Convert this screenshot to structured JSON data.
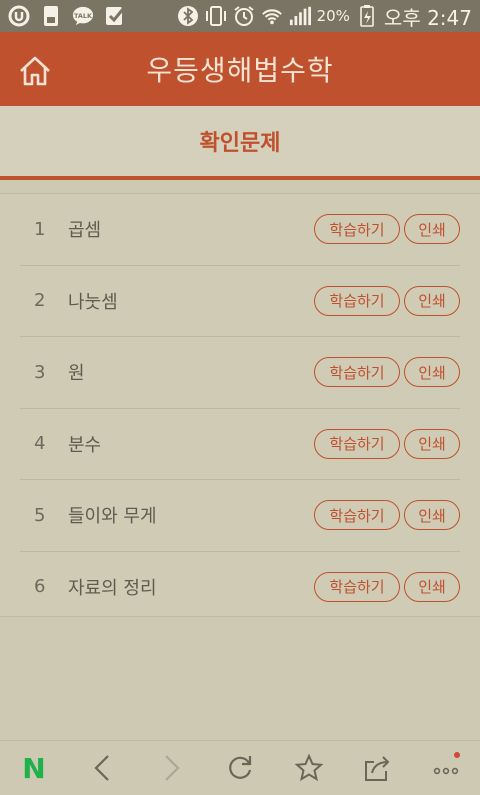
{
  "status_bar": {
    "icons": [
      "u-plus-icon",
      "sim-icon",
      "talk-icon",
      "check-icon",
      "bluetooth-icon",
      "vibrate-icon",
      "alarm-icon",
      "wifi-icon",
      "signal-icon",
      "battery-icon"
    ],
    "talk_label": "TALK",
    "battery": "20%",
    "time": "오후 2:47"
  },
  "app": {
    "title": "우등생해법수학",
    "accent_color": "#c0512f"
  },
  "section": {
    "title": "확인문제"
  },
  "items": [
    {
      "num": "1",
      "title": "곱셈",
      "study": "학습하기",
      "print": "인쇄"
    },
    {
      "num": "2",
      "title": "나눗셈",
      "study": "학습하기",
      "print": "인쇄"
    },
    {
      "num": "3",
      "title": "원",
      "study": "학습하기",
      "print": "인쇄"
    },
    {
      "num": "4",
      "title": "분수",
      "study": "학습하기",
      "print": "인쇄"
    },
    {
      "num": "5",
      "title": "들이와 무게",
      "study": "학습하기",
      "print": "인쇄"
    },
    {
      "num": "6",
      "title": "자료의 정리",
      "study": "학습하기",
      "print": "인쇄"
    }
  ],
  "toolbar": {
    "icons": [
      "naver-icon",
      "back-icon",
      "forward-icon",
      "refresh-icon",
      "star-icon",
      "share-icon",
      "more-icon"
    ],
    "naver_label": "N"
  }
}
